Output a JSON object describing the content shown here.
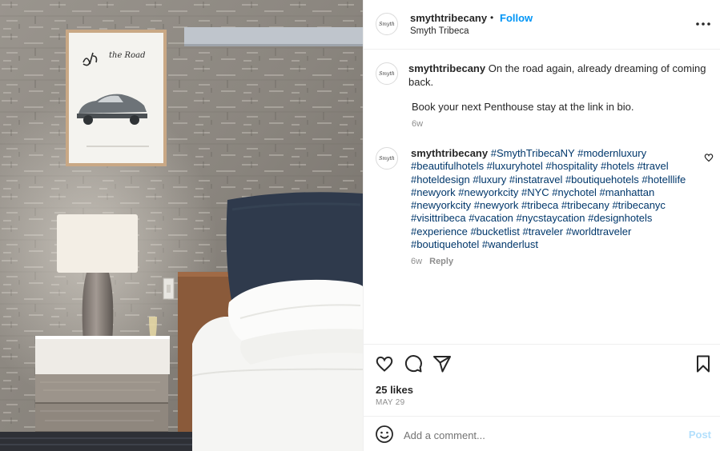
{
  "photo": {
    "poster_caption": "On The Road"
  },
  "header": {
    "username": "smythtribecany",
    "separator": "•",
    "follow_label": "Follow",
    "subtitle": "Smyth Tribeca",
    "avatar_text": "Smyth"
  },
  "caption": {
    "username": "smythtribecany",
    "text": "On the road again, already dreaming of coming back.",
    "book_text": "Book your next Penthouse stay at the link in bio.",
    "time": "6w"
  },
  "comment": {
    "username": "smythtribecany",
    "tags": "#SmythTribecaNY #modernluxury #beautifulhotels #luxuryhotel #hospitality #hotels #travel #hoteldesign #luxury #instatravel #boutiquehotels #hotelllife #newyork #newyorkcity #NYC #nychotel #manhattan #newyorkcity #newyork #tribeca #tribecany #tribecanyc #visittribeca #vacation #nycstaycation #designhotels #experience #bucketlist #traveler #worldtraveler #boutiquehotel #wanderlust",
    "time": "6w",
    "reply_label": "Reply"
  },
  "actions": {
    "likes": "25 likes",
    "date": "MAY 29"
  },
  "comment_box": {
    "placeholder": "Add a comment...",
    "post_label": "Post"
  },
  "colors": {
    "link_blue": "#0095f6",
    "hashtag_blue": "#00376b",
    "muted_gray": "#8e8e8e",
    "post_disabled": "#b2dffc"
  }
}
